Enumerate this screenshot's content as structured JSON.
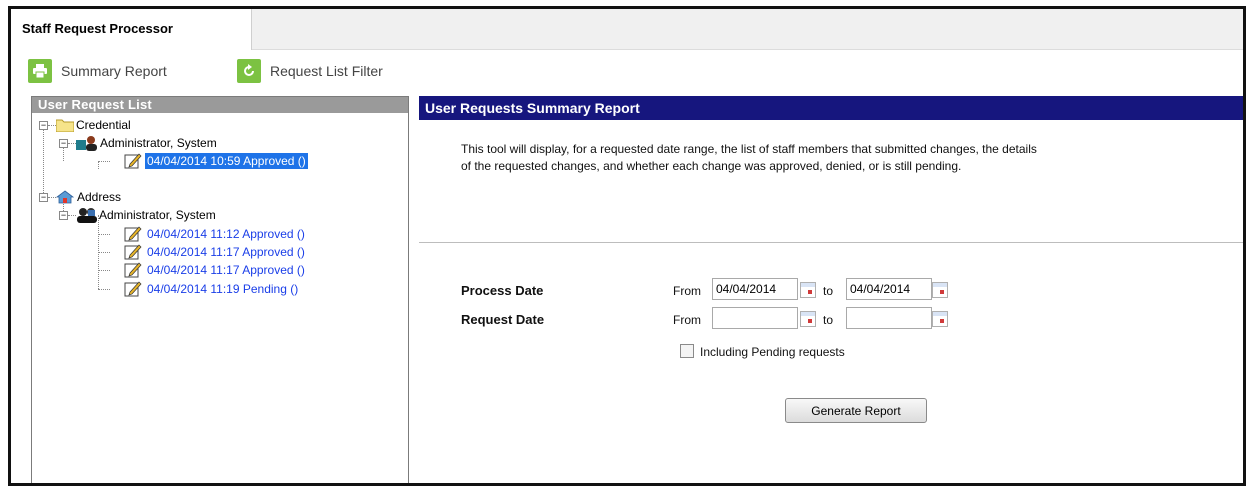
{
  "app": {
    "tab_title": "Staff Request Processor"
  },
  "toolbar": {
    "summary_report": "Summary Report",
    "request_list_filter": "Request List Filter"
  },
  "left_pane": {
    "title": "User Request List",
    "groups": [
      {
        "label": "Credential",
        "user": "Administrator, System",
        "requests": [
          {
            "text": "04/04/2014 10:59  Approved ()",
            "selected": true
          }
        ]
      },
      {
        "label": "Address",
        "user": "Administrator, System",
        "requests": [
          {
            "text": "04/04/2014 11:12  Approved ()",
            "selected": false
          },
          {
            "text": "04/04/2014 11:17  Approved ()",
            "selected": false
          },
          {
            "text": "04/04/2014 11:17  Approved ()",
            "selected": false
          },
          {
            "text": "04/04/2014 11:19  Pending ()",
            "selected": false
          }
        ]
      }
    ]
  },
  "right_pane": {
    "title": "User Requests Summary Report",
    "description_line1": "This tool will display, for a requested date range, the list of staff members that submitted changes, the details",
    "description_line2": "of the requested changes, and whether each change was approved, denied, or is still pending.",
    "process_date": {
      "label": "Process Date",
      "from_label": "From",
      "to_label": "to",
      "from_value": "04/04/2014",
      "to_value": "04/04/2014"
    },
    "request_date": {
      "label": "Request Date",
      "from_label": "From",
      "to_label": "to",
      "from_value": "",
      "to_value": ""
    },
    "include_pending_label": "Including Pending requests",
    "include_pending_checked": false,
    "generate_button": "Generate Report"
  },
  "colors": {
    "accent_green": "#7cc242",
    "header_navy": "#16167e",
    "selection_blue": "#1e73e8",
    "link_blue": "#1a3ee8"
  }
}
